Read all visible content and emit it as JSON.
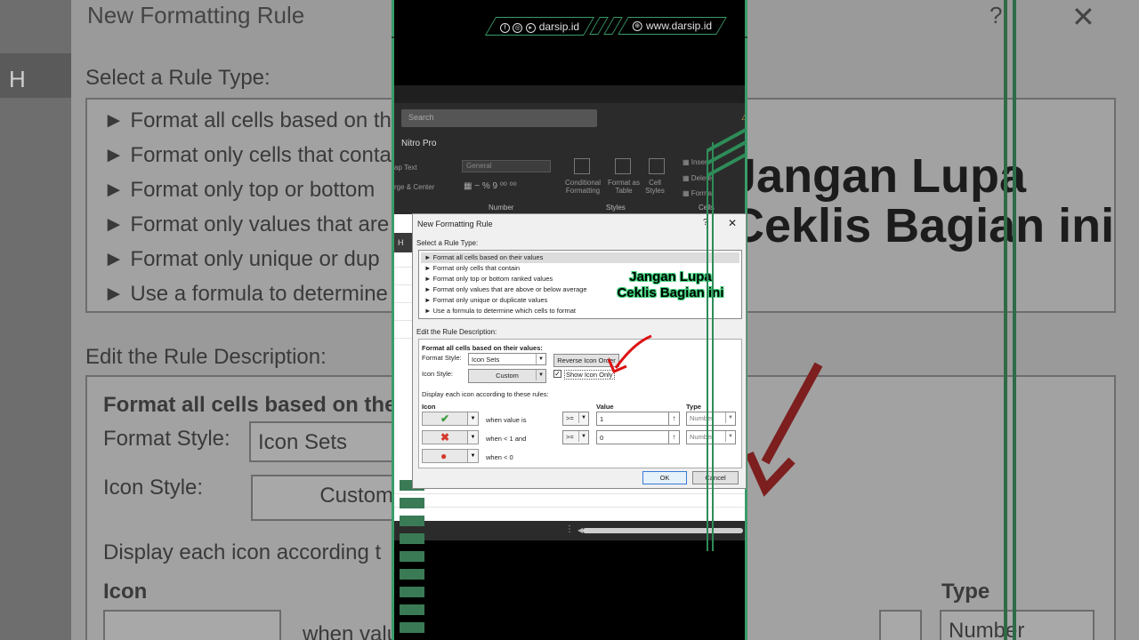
{
  "social": {
    "handle": "darsip.id",
    "website": "www.darsip.id"
  },
  "ribbon": {
    "search_placeholder": "Search",
    "addin": "Nitro Pro",
    "wrap_text": "ap Text",
    "merge_center": "rge & Center",
    "number_format": "General",
    "number_group": "Number",
    "styles_group": "Styles",
    "cells_group": "Cells",
    "conditional_formatting": "Conditional Formatting",
    "format_as_table": "Format as Table",
    "cell_styles": "Cell Styles",
    "insert": "Insert",
    "delete": "Delete",
    "format": "Format",
    "col_header": "H"
  },
  "dialog": {
    "title": "New Formatting Rule",
    "help": "?",
    "close": "✕",
    "select_rule_type": "Select a Rule Type:",
    "rule_types": [
      "Format all cells based on their values",
      "Format only cells that contain",
      "Format only top or bottom ranked values",
      "Format only values that are above or below average",
      "Format only unique or duplicate values",
      "Use a formula to determine which cells to format"
    ],
    "edit_desc": "Edit the Rule Description:",
    "format_all_heading": "Format all cells based on their values:",
    "format_style_label": "Format Style:",
    "format_style_value": "Icon Sets",
    "reverse_icon_order": "Reverse Icon Order",
    "icon_style_label": "Icon Style:",
    "icon_style_value": "Custom",
    "show_icon_only": "Show Icon Only",
    "display_rule_text": "Display each icon according to these rules:",
    "col_icon": "Icon",
    "col_value": "Value",
    "col_type": "Type",
    "rows": [
      {
        "icon": "✔",
        "icon_color": "#3e9b3e",
        "condition": "when value is",
        "operator": ">=",
        "value": "1",
        "type": "Number"
      },
      {
        "icon": "✖",
        "icon_color": "#d33a2c",
        "condition": "when < 1 and",
        "operator": ">=",
        "value": "0",
        "type": "Number"
      },
      {
        "icon": "●",
        "icon_color": "#d33a2c",
        "condition": "when < 0"
      }
    ],
    "ok": "OK",
    "cancel": "Cancel"
  },
  "overlay": {
    "line1": "Jangan Lupa",
    "line2": "Ceklis Bagian ini"
  },
  "background": {
    "title": "New Formatting Rule",
    "help": "?",
    "close": "✕",
    "col_header": "H",
    "select_rule_type": "Select a Rule Type:",
    "items": [
      "Format all cells based on th",
      "Format only cells that conta",
      "Format only top or bottom",
      "Format only values that are",
      "Format only unique or dup",
      "Use a formula to determine"
    ],
    "edit_desc": "Edit the Rule Description:",
    "format_all": "Format all cells based on the",
    "format_style": "Format Style:",
    "icon_sets": "Icon Sets",
    "icon_style": "Icon Style:",
    "custom": "Custom",
    "display_each": "Display each icon according t",
    "icon": "Icon",
    "when_val": "when valu",
    "type": "Type",
    "number": "Number",
    "big_line1": "Jangan Lupa",
    "big_line2": "Ceklis Bagian ini"
  }
}
